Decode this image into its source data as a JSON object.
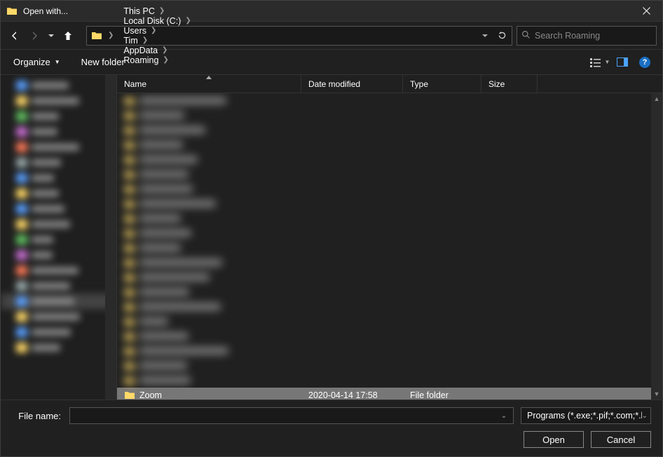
{
  "title": "Open with...",
  "breadcrumbs": [
    "This PC",
    "Local Disk (C:)",
    "Users",
    "Tim",
    "AppData",
    "Roaming"
  ],
  "search_placeholder": "Search Roaming",
  "toolbar": {
    "organize": "Organize",
    "new_folder": "New folder"
  },
  "columns": {
    "name": "Name",
    "date": "Date modified",
    "type": "Type",
    "size": "Size"
  },
  "col_widths": {
    "name": 263,
    "date": 145,
    "type": 112,
    "size": 80
  },
  "selected_row": {
    "name": "Zoom",
    "date": "2020-04-14 17:58",
    "type": "File folder",
    "size": ""
  },
  "filename_label": "File name:",
  "filename_value": "",
  "filter_label": "Programs (*.exe;*.pif;*.com;*.bat)",
  "buttons": {
    "open": "Open",
    "cancel": "Cancel"
  },
  "blurred_rows": 20,
  "tree_items": 18
}
